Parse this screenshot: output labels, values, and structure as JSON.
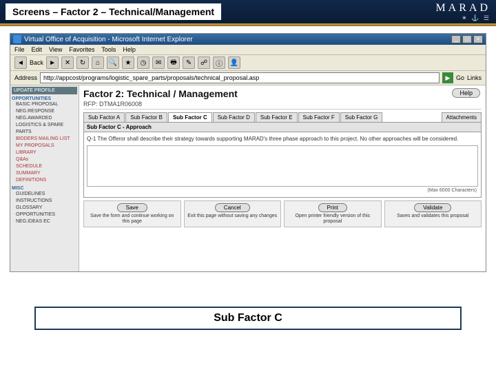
{
  "slide": {
    "title": "Screens – Factor 2 – Technical/Management",
    "brand": "MARAD",
    "brand_glyphs": "✶ ⚓ ☰"
  },
  "ie": {
    "window_title": "Virtual Office of Acquisition - Microsoft Internet Explorer",
    "menu": [
      "File",
      "Edit",
      "View",
      "Favorites",
      "Tools",
      "Help"
    ],
    "back": "Back",
    "address_label": "Address",
    "address_value": "http://appcost/programs/logistic_spare_parts/proposals/technical_proposal.asp",
    "go": "Go",
    "links": "Links"
  },
  "sidebar": {
    "update_profile": "UPDATE PROFILE",
    "sec1": "OPPORTUNITIES",
    "items1": [
      "BASIC PROPOSAL",
      "NEG.RESPONSE",
      "NEG.AWARDED",
      "LOGISTICS & SPARE PARTS"
    ],
    "items2": [
      "BIDDERS MAILING LIST",
      "MY PROPOSALS",
      "LIBRARY",
      "Q&As",
      "SCHEDULE",
      "SUMMARY",
      "DEFINITIONS"
    ],
    "sec2": "MISC",
    "items3": [
      "GUIDELINES",
      "INSTRUCTIONS",
      "GLOSSARY",
      "OPPORTUNITIES",
      "NEG.IDEAS EC"
    ]
  },
  "main": {
    "title": "Factor 2: Technical / Management",
    "rfp": "RFP: DTMA1R06008",
    "help": "Help",
    "tabs": [
      "Sub Factor A",
      "Sub Factor B",
      "Sub Factor C",
      "Sub Factor D",
      "Sub Factor E",
      "Sub Factor F",
      "Sub Factor G"
    ],
    "active_tab": "Sub Factor C",
    "attachments": "Attachments",
    "panel_title": "Sub Factor C - Approach",
    "question": "Q-1 The Offeror shall describe their strategy towards supporting MARAD's three phase approach to this project. No other approaches will be considered.",
    "char_note": "(Max 6000 Characters)"
  },
  "actions": [
    {
      "label": "Save",
      "desc": "Save the form and continue working on this page"
    },
    {
      "label": "Cancel",
      "desc": "Exit this page without saving any changes"
    },
    {
      "label": "Print",
      "desc": "Open printer friendly version of this proposal"
    },
    {
      "label": "Validate",
      "desc": "Saves and validates this proposal"
    }
  ],
  "caption": "Sub Factor C"
}
